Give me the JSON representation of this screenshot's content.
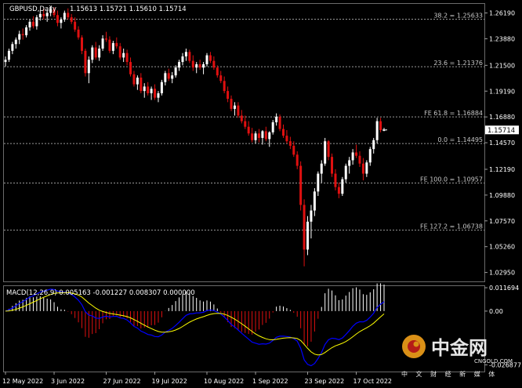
{
  "title": "GBPUSD,Daily",
  "ohlc_text": "1.15613 1.15721 1.15610 1.15714",
  "current_price_label": "1.15714",
  "macd_label": "MACD(12,26,9) 0.005163 -0.001227 0.008307 0.000000",
  "watermark": {
    "cn": "中金网",
    "en": "CNGOLD.COM",
    "sub": "中 文 财 经 新 媒 体"
  },
  "colors": {
    "background": "#000000",
    "bull": "#ffffff",
    "bear": "#e01010",
    "macd_line": "#0000ff",
    "signal_line": "#ffff00",
    "level_line": "#9a9a9a",
    "current_box": "#ffffff"
  },
  "chart_data": [
    {
      "type": "candlestick",
      "symbol": "GBPUSD",
      "timeframe": "Daily",
      "ylim": [
        1.0215,
        1.27
      ],
      "y_ticks": [
        "1.26190",
        "1.23880",
        "1.21500",
        "1.19190",
        "1.16880",
        "1.14570",
        "1.12190",
        "1.09880",
        "1.07570",
        "1.05260",
        "1.02950"
      ],
      "x_labels": [
        "12 May 2022",
        "3 Jun 2022",
        "27 Jun 2022",
        "19 Jul 2022",
        "10 Aug 2022",
        "1 Sep 2022",
        "23 Sep 2022",
        "17 Oct 2022"
      ],
      "levels": [
        {
          "label": "38.2 = 1.25633",
          "value": 1.25633
        },
        {
          "label": "23.6 = 1.21376",
          "value": 1.21376
        },
        {
          "label": "FE 61.8 = 1.16884",
          "value": 1.16884
        },
        {
          "label": "0.0 = 1.14495",
          "value": 1.14495
        },
        {
          "label": "FE 100.0 = 1.10957",
          "value": 1.10957
        },
        {
          "label": "FE 127.2 = 1.06738",
          "value": 1.06738
        }
      ],
      "candles": [
        [
          1.218,
          1.223,
          1.214,
          1.22
        ],
        [
          1.22,
          1.23,
          1.218,
          1.228
        ],
        [
          1.228,
          1.236,
          1.225,
          1.234
        ],
        [
          1.234,
          1.24,
          1.23,
          1.238
        ],
        [
          1.238,
          1.246,
          1.234,
          1.243
        ],
        [
          1.243,
          1.248,
          1.238,
          1.242
        ],
        [
          1.242,
          1.251,
          1.24,
          1.249
        ],
        [
          1.249,
          1.256,
          1.246,
          1.254
        ],
        [
          1.254,
          1.259,
          1.248,
          1.25
        ],
        [
          1.25,
          1.26,
          1.247,
          1.258
        ],
        [
          1.258,
          1.264,
          1.255,
          1.261
        ],
        [
          1.261,
          1.266,
          1.256,
          1.259
        ],
        [
          1.259,
          1.264,
          1.254,
          1.262
        ],
        [
          1.262,
          1.268,
          1.259,
          1.265
        ],
        [
          1.265,
          1.267,
          1.258,
          1.26
        ],
        [
          1.26,
          1.264,
          1.25,
          1.253
        ],
        [
          1.253,
          1.258,
          1.248,
          1.256
        ],
        [
          1.256,
          1.264,
          1.254,
          1.262
        ],
        [
          1.262,
          1.266,
          1.256,
          1.258
        ],
        [
          1.258,
          1.261,
          1.252,
          1.254
        ],
        [
          1.254,
          1.258,
          1.245,
          1.247
        ],
        [
          1.247,
          1.25,
          1.238,
          1.24
        ],
        [
          1.24,
          1.242,
          1.225,
          1.228
        ],
        [
          1.228,
          1.23,
          1.205,
          1.208
        ],
        [
          1.208,
          1.223,
          1.199,
          1.22
        ],
        [
          1.22,
          1.233,
          1.217,
          1.231
        ],
        [
          1.231,
          1.236,
          1.22,
          1.222
        ],
        [
          1.222,
          1.233,
          1.219,
          1.23
        ],
        [
          1.23,
          1.242,
          1.228,
          1.239
        ],
        [
          1.239,
          1.245,
          1.236,
          1.238
        ],
        [
          1.238,
          1.241,
          1.226,
          1.228
        ],
        [
          1.228,
          1.237,
          1.225,
          1.235
        ],
        [
          1.235,
          1.24,
          1.23,
          1.232
        ],
        [
          1.232,
          1.235,
          1.22,
          1.222
        ],
        [
          1.222,
          1.23,
          1.218,
          1.226
        ],
        [
          1.226,
          1.229,
          1.215,
          1.218
        ],
        [
          1.218,
          1.222,
          1.205,
          1.207
        ],
        [
          1.207,
          1.21,
          1.196,
          1.198
        ],
        [
          1.198,
          1.206,
          1.193,
          1.204
        ],
        [
          1.204,
          1.208,
          1.19,
          1.192
        ],
        [
          1.192,
          1.199,
          1.186,
          1.196
        ],
        [
          1.196,
          1.2,
          1.188,
          1.19
        ],
        [
          1.19,
          1.196,
          1.184,
          1.194
        ],
        [
          1.194,
          1.198,
          1.184,
          1.186
        ],
        [
          1.186,
          1.192,
          1.182,
          1.19
        ],
        [
          1.19,
          1.202,
          1.188,
          1.2
        ],
        [
          1.2,
          1.21,
          1.197,
          1.208
        ],
        [
          1.208,
          1.212,
          1.201,
          1.203
        ],
        [
          1.203,
          1.209,
          1.199,
          1.206
        ],
        [
          1.206,
          1.215,
          1.204,
          1.213
        ],
        [
          1.213,
          1.22,
          1.21,
          1.218
        ],
        [
          1.218,
          1.226,
          1.215,
          1.223
        ],
        [
          1.223,
          1.23,
          1.219,
          1.227
        ],
        [
          1.227,
          1.229,
          1.217,
          1.219
        ],
        [
          1.219,
          1.224,
          1.21,
          1.213
        ],
        [
          1.213,
          1.218,
          1.208,
          1.216
        ],
        [
          1.216,
          1.22,
          1.211,
          1.213
        ],
        [
          1.213,
          1.218,
          1.207,
          1.216
        ],
        [
          1.216,
          1.226,
          1.214,
          1.224
        ],
        [
          1.224,
          1.227,
          1.217,
          1.219
        ],
        [
          1.219,
          1.223,
          1.211,
          1.213
        ],
        [
          1.213,
          1.215,
          1.204,
          1.206
        ],
        [
          1.206,
          1.21,
          1.199,
          1.201
        ],
        [
          1.201,
          1.205,
          1.19,
          1.192
        ],
        [
          1.192,
          1.196,
          1.182,
          1.185
        ],
        [
          1.185,
          1.188,
          1.174,
          1.176
        ],
        [
          1.176,
          1.182,
          1.17,
          1.179
        ],
        [
          1.179,
          1.182,
          1.168,
          1.17
        ],
        [
          1.17,
          1.175,
          1.163,
          1.165
        ],
        [
          1.165,
          1.17,
          1.158,
          1.16
        ],
        [
          1.16,
          1.165,
          1.152,
          1.154
        ],
        [
          1.154,
          1.159,
          1.146,
          1.148
        ],
        [
          1.148,
          1.156,
          1.145,
          1.154
        ],
        [
          1.154,
          1.158,
          1.146,
          1.15
        ],
        [
          1.15,
          1.157,
          1.144,
          1.156
        ],
        [
          1.156,
          1.16,
          1.147,
          1.149
        ],
        [
          1.149,
          1.156,
          1.142,
          1.155
        ],
        [
          1.155,
          1.166,
          1.153,
          1.164
        ],
        [
          1.164,
          1.172,
          1.161,
          1.169
        ],
        [
          1.169,
          1.171,
          1.156,
          1.158
        ],
        [
          1.158,
          1.162,
          1.15,
          1.152
        ],
        [
          1.152,
          1.157,
          1.145,
          1.147
        ],
        [
          1.147,
          1.151,
          1.14,
          1.143
        ],
        [
          1.143,
          1.147,
          1.133,
          1.135
        ],
        [
          1.135,
          1.138,
          1.122,
          1.125
        ],
        [
          1.125,
          1.129,
          1.085,
          1.09
        ],
        [
          1.09,
          1.095,
          1.035,
          1.05
        ],
        [
          1.05,
          1.08,
          1.045,
          1.075
        ],
        [
          1.075,
          1.09,
          1.06,
          1.085
        ],
        [
          1.085,
          1.105,
          1.08,
          1.102
        ],
        [
          1.102,
          1.12,
          1.098,
          1.118
        ],
        [
          1.118,
          1.13,
          1.11,
          1.127
        ],
        [
          1.127,
          1.15,
          1.125,
          1.147
        ],
        [
          1.147,
          1.148,
          1.13,
          1.133
        ],
        [
          1.133,
          1.136,
          1.115,
          1.118
        ],
        [
          1.118,
          1.122,
          1.103,
          1.106
        ],
        [
          1.106,
          1.11,
          1.096,
          1.1
        ],
        [
          1.1,
          1.115,
          1.098,
          1.113
        ],
        [
          1.113,
          1.127,
          1.11,
          1.125
        ],
        [
          1.125,
          1.133,
          1.118,
          1.13
        ],
        [
          1.13,
          1.14,
          1.126,
          1.137
        ],
        [
          1.137,
          1.144,
          1.132,
          1.134
        ],
        [
          1.134,
          1.138,
          1.124,
          1.127
        ],
        [
          1.127,
          1.132,
          1.112,
          1.118
        ],
        [
          1.118,
          1.13,
          1.115,
          1.128
        ],
        [
          1.128,
          1.142,
          1.125,
          1.14
        ],
        [
          1.14,
          1.15,
          1.136,
          1.148
        ],
        [
          1.148,
          1.168,
          1.145,
          1.165
        ],
        [
          1.165,
          1.168,
          1.155,
          1.157
        ],
        [
          1.157,
          1.159,
          1.156,
          1.1571
        ]
      ],
      "current_price": 1.15714
    },
    {
      "type": "macd",
      "label": "MACD(12,26,9)",
      "macd": 0.005163,
      "signal": -0.001227,
      "histogram": 0.008307,
      "zero": 0.0,
      "ylim": [
        -0.0302,
        0.0125
      ],
      "y_ticks": [
        "0.011694",
        "0.00",
        "-0.026877"
      ]
    }
  ]
}
